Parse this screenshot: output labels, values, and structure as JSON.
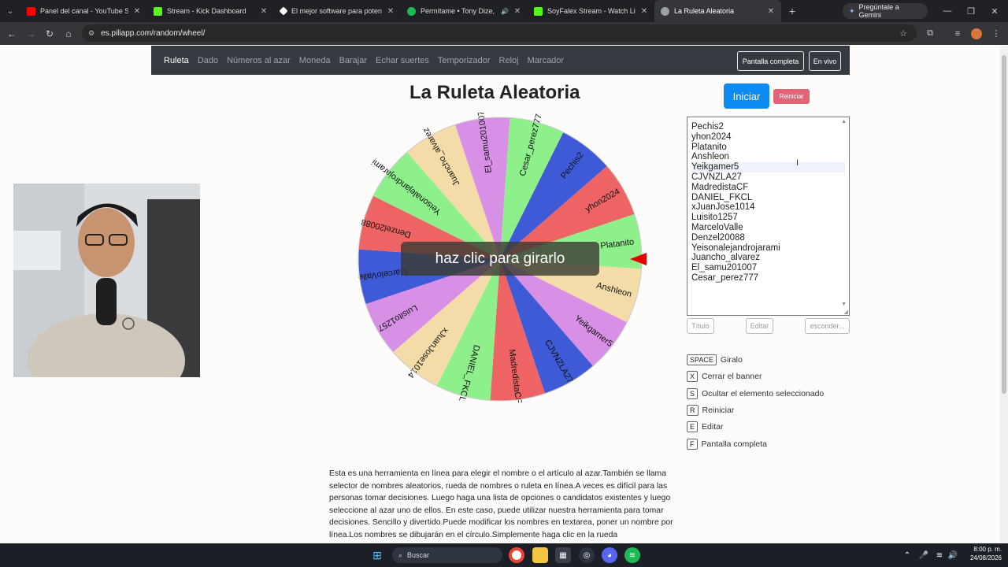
{
  "browser": {
    "tabs": [
      {
        "title": "Panel del canal - YouTube Studio",
        "color": "#ff0000"
      },
      {
        "title": "Stream - Kick Dashboard",
        "color": "#53fc18"
      },
      {
        "title": "El mejor software para potenciar",
        "color": "#ffffff"
      },
      {
        "title": "Permítame • Tony Dize, Yandel",
        "color": "#1db954"
      },
      {
        "title": "SoyFalex Stream - Watch Live o",
        "color": "#53fc18"
      },
      {
        "title": "La Ruleta Aleatoria",
        "color": "#9aa0a6"
      }
    ],
    "gemini_label": "Pregúntale a Gemini",
    "url": "es.piliapp.com/random/wheel/"
  },
  "site_nav": {
    "items": [
      "Ruleta",
      "Dado",
      "Números al azar",
      "Moneda",
      "Barajar",
      "Echar suertes",
      "Temporizador",
      "Reloj",
      "Marcador"
    ],
    "fullscreen_label": "Pantalla completa",
    "live_label": "En vivo"
  },
  "page": {
    "title": "La Ruleta Aleatoria",
    "start_label": "Iniciar",
    "reset_label": "Reiniciar",
    "overlay_label": "haz clic para girarlo"
  },
  "wheel": {
    "names": [
      "Pechis2",
      "yhon2024",
      "Platanito",
      "Anshleon",
      "Yeikgamer5",
      "CJVNZLA27",
      "MadredistaCF",
      "DANIEL_FKCL",
      "xJuanJose1014",
      "Luisito1257",
      "MarceloValle",
      "Denzel20088",
      "Yeisonalejandrojarami",
      "Juancho_alvarez",
      "El_samu201007",
      "Cesar_perez777"
    ],
    "colors": [
      "#3f5ad6",
      "#ee6464",
      "#8ef08a",
      "#f4dca8",
      "#d790e6"
    ]
  },
  "editor": {
    "title_btn": "Título",
    "edit_btn": "Editar",
    "hide_btn": "esconder..."
  },
  "shortcuts": [
    {
      "key": "SPACE",
      "label": "Giralo"
    },
    {
      "key": "X",
      "label": "Cerrar el banner"
    },
    {
      "key": "S",
      "label": "Ocultar el elemento seleccionado"
    },
    {
      "key": "R",
      "label": "Reiniciar"
    },
    {
      "key": "E",
      "label": "Editar"
    },
    {
      "key": "F",
      "label": "Pantalla completa"
    }
  ],
  "description": "Esta es una herramienta en línea para elegir el nombre o el artículo al azar.También se llama selector de nombres aleatorios, rueda de nombres o ruleta en línea.A veces es difícil para las personas tomar decisiones. Luego haga una lista de opciones o candidatos existentes y luego seleccione al azar uno de ellos. En este caso, puede utilizar nuestra herramienta para tomar decisiones. Sencillo y divertido.Puede modificar los nombres en textarea, poner un nombre por línea.Los nombres se dibujarán en el círculo.Simplemente haga clic en la rueda",
  "taskbar": {
    "search_label": "Buscar",
    "time": "8:00 p. m.",
    "date": "24/08/2026"
  }
}
